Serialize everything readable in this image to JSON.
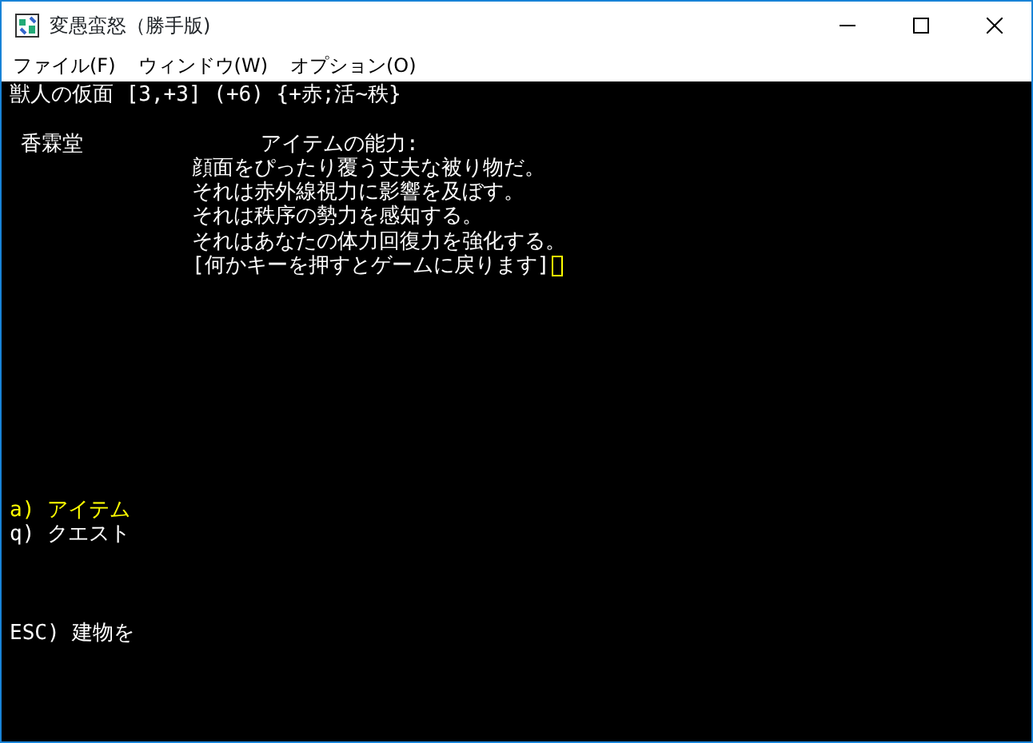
{
  "window": {
    "title": "変愚蛮怒（勝手版)"
  },
  "menu": [
    "ファイル(F)",
    "ウィンドウ(W)",
    "オプション(O)"
  ],
  "terminal": {
    "status_line": "獣人の仮面 [3,+3] (+6) {+赤;活~秩}",
    "shop_name": "香霖堂",
    "ability_heading": "アイテムの能力:",
    "ability_lines": [
      "顔面をぴったり覆う丈夫な被り物だ。",
      "それは赤外線視力に影響を及ぼす。",
      "それは秩序の勢力を感知する。",
      "それはあなたの体力回復力を強化する。"
    ],
    "prompt": "[何かキーを押すとゲームに戻ります]",
    "cursor": true,
    "commands": [
      {
        "label": "a) アイテム",
        "selected": true
      },
      {
        "label": "q) クエスト",
        "selected": false
      }
    ],
    "escape_command": "ESC) 建物を"
  }
}
